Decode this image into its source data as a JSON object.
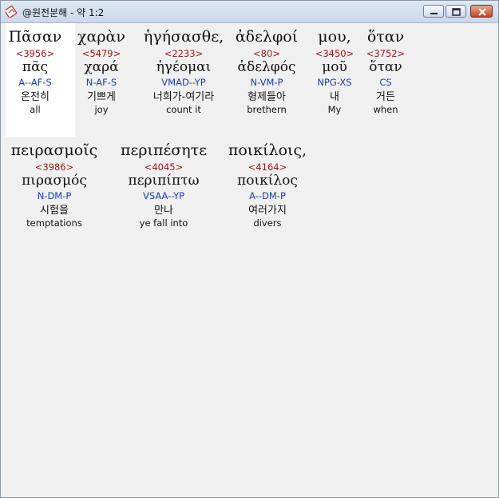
{
  "window": {
    "title": "@원전분해 - 약 1:2"
  },
  "words": [
    {
      "greek": "Πᾶσαν",
      "strong": "<3956>",
      "lemma": "πᾶς",
      "morph": "A--AF-S",
      "korean": "온전히",
      "english": "all",
      "selected": true
    },
    {
      "greek": "χαρὰν",
      "strong": "<5479>",
      "lemma": "χαρά",
      "morph": "N-AF-S",
      "korean": "기쁘게",
      "english": "joy"
    },
    {
      "greek": "ἡγήσασθε,",
      "strong": "<2233>",
      "lemma": "ἡγέομαι",
      "morph": "VMAD--YP",
      "korean": "너희가-여기라",
      "english": "count it"
    },
    {
      "greek": "ἀδελφοί",
      "strong": "<80>",
      "lemma": "ἀδελφός",
      "morph": "N-VM-P",
      "korean": "형제들아",
      "english": "brethern"
    },
    {
      "greek": "μου,",
      "strong": "<3450>",
      "lemma": "μοῦ",
      "morph": "NPG-XS",
      "korean": "내",
      "english": "My"
    },
    {
      "greek": "ὅταν",
      "strong": "<3752>",
      "lemma": "ὅταν",
      "morph": "CS",
      "korean": "거든",
      "english": "when"
    },
    {
      "greek": "πειρασμοῖς",
      "strong": "<3986>",
      "lemma": "πιρασμός",
      "morph": "N-DM-P",
      "korean": "시험을",
      "english": "temptations"
    },
    {
      "greek": "περιπέσητε",
      "strong": "<4045>",
      "lemma": "περιπίπτω",
      "morph": "VSAA--YP",
      "korean": "만나",
      "english": "ye fall into"
    },
    {
      "greek": "ποικίλοις,",
      "strong": "<4164>",
      "lemma": "ποικίλος",
      "morph": "A--DM-P",
      "korean": "여러가지",
      "english": "divers"
    }
  ]
}
